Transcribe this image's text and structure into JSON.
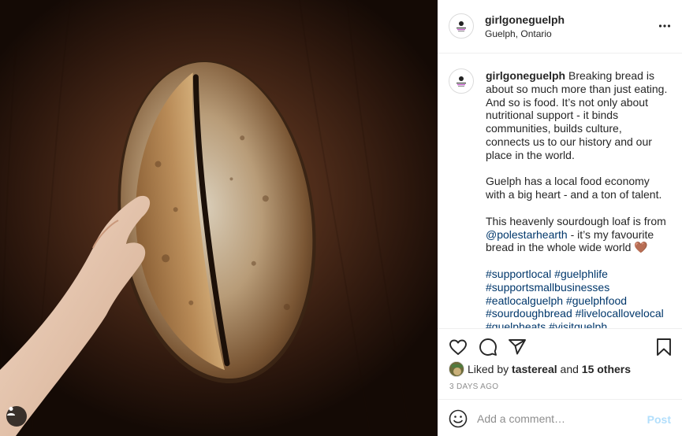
{
  "post": {
    "username": "girlgoneguelph",
    "location": "Guelph, Ontario",
    "caption": {
      "username": "girlgoneguelph",
      "part1": " Breaking bread is about so much more than just eating. And so is food. It’s not only about nutritional support - it binds communities, builds culture, connects us to our history and our place in the world.\n\nGuelph has a local food economy with a big heart - and a ton of talent.\n\nThis heavenly sourdough loaf is from ",
      "mention": "@polestarhearth",
      "part2": " - it’s my favourite bread in the whole wide world 🤎\n\n",
      "hashtags": "#supportlocal #guelphlife #supportsmallbusinesses #eatlocalguelph #guelphfood #sourdoughbread #livelocallovelocal #guelpheats #visitguelph"
    },
    "likes": {
      "prefix": "Liked by ",
      "user": "tastereal",
      "middle": " and ",
      "others": "15 others"
    },
    "timestamp": "3 DAYS AGO"
  },
  "comment_box": {
    "placeholder": "Add a comment…",
    "post_label": "Post"
  },
  "icons": {
    "like": "heart-icon",
    "comment": "comment-icon",
    "share": "share-icon",
    "save": "bookmark-icon",
    "emoji": "emoji-icon",
    "more": "more-icon",
    "tag": "user-tag-icon"
  },
  "colors": {
    "link": "#00376b",
    "post_disabled": "#b2dffc",
    "muted": "#8e8e8e",
    "text": "#262626"
  }
}
